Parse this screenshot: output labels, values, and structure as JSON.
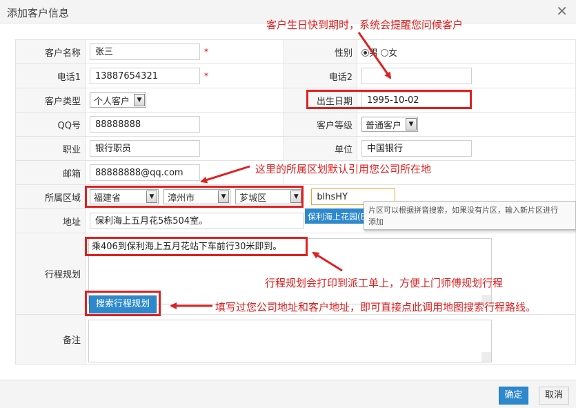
{
  "dialog": {
    "title": "添加客户信息"
  },
  "form": {
    "customer_name": {
      "label": "客户名称",
      "value": "张三"
    },
    "gender": {
      "label": "性别",
      "options": [
        "男",
        "女"
      ],
      "selected": "男"
    },
    "phone1": {
      "label": "电话1",
      "value": "13887654321"
    },
    "phone2": {
      "label": "电话2",
      "value": ""
    },
    "customer_type": {
      "label": "客户类型",
      "value": "个人客户"
    },
    "birthday": {
      "label": "出生日期",
      "value": "1995-10-02"
    },
    "qq": {
      "label": "QQ号",
      "value": "88888888"
    },
    "level": {
      "label": "客户等级",
      "value": "普通客户"
    },
    "job": {
      "label": "职业",
      "value": "银行职员"
    },
    "company": {
      "label": "单位",
      "value": "中国银行"
    },
    "email": {
      "label": "邮箱",
      "value": "88888888@qq.com"
    },
    "region": {
      "label": "所属区域",
      "province": "福建省",
      "city": "漳州市",
      "district": "芗城区",
      "area_input": "blhsHY",
      "suggestion": "保利海上花园(B"
    },
    "address": {
      "label": "地址",
      "value": "保利海上五月花5栋504室。"
    },
    "route": {
      "label": "行程规划",
      "value": "乘406到保利海上五月花站下车前行30米即到。",
      "search_button": "搜索行程规划"
    },
    "remark": {
      "label": "备注",
      "value": ""
    }
  },
  "tooltip": {
    "line1": "片区可以根据拼音搜索，如果没有片区，输入新片区进行",
    "line2": "添加"
  },
  "annotations": {
    "birthday": "客户生日快到期时，系统会提醒您问候客户",
    "region": "这里的所属区划默认引用您公司所在地",
    "route": "行程规划会打印到派工单上，方便上门师傅规划行程",
    "search": "填写过您公司地址和客户地址，即可直接点此调用地图搜索行程路线。"
  },
  "footer": {
    "ok": "确定",
    "cancel": "取消"
  },
  "colors": {
    "accent": "#2d88cc",
    "annotation": "#e02020"
  },
  "icons": {
    "close": "close-icon",
    "dropdown": "chevron-down-icon"
  }
}
